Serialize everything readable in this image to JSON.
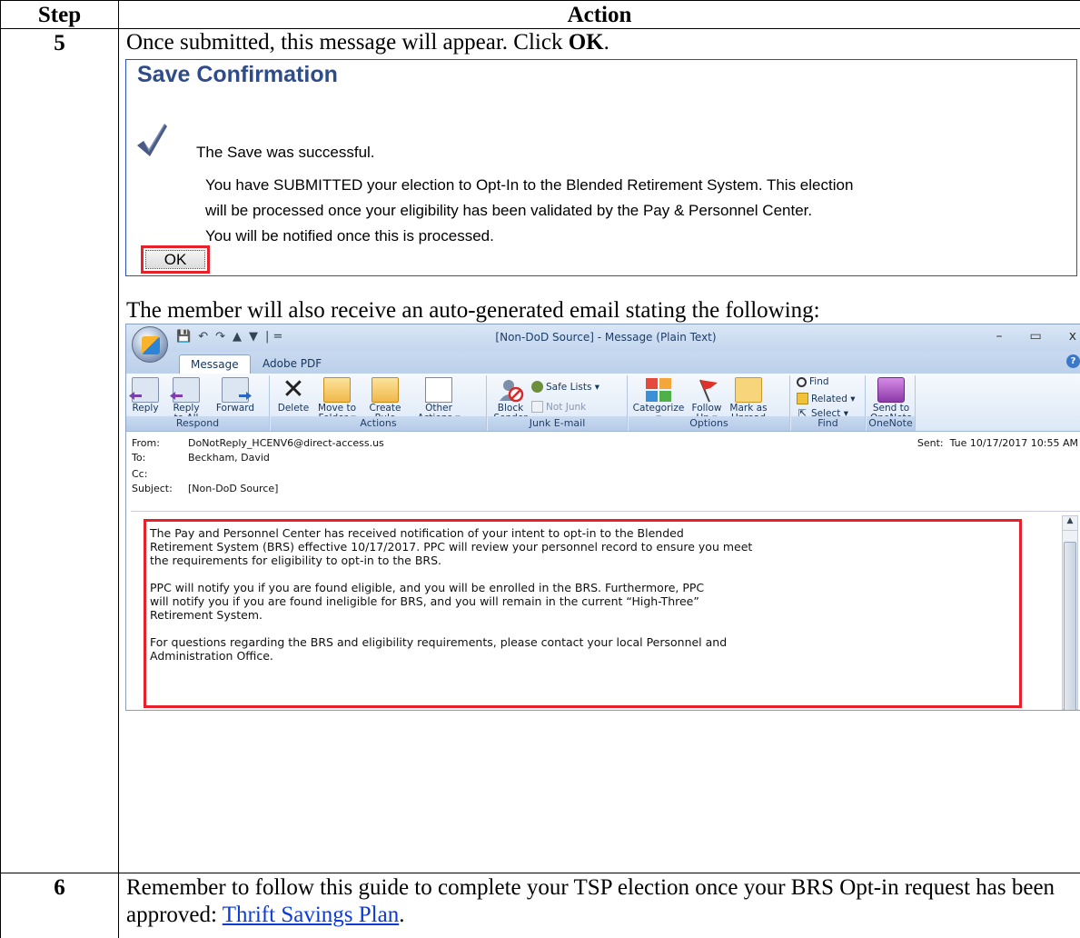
{
  "table": {
    "col_step": "Step",
    "col_action": "Action",
    "rows": [
      {
        "step": "5",
        "intro_prefix": "Once submitted, this message will appear. Click ",
        "intro_bold": "OK",
        "intro_suffix": "."
      },
      {
        "step": "6",
        "text_prefix": "Remember to follow this guide to complete your TSP election once your BRS Opt-in request has been approved: ",
        "link": "Thrift Savings Plan",
        "text_suffix": "."
      }
    ]
  },
  "save_confirmation": {
    "title": "Save Confirmation",
    "success": "The Save was successful.",
    "lines": [
      "You have SUBMITTED your election to Opt-In to the Blended Retirement System. This election",
      "will be processed once your eligibility has been validated by the Pay & Personnel Center.",
      "You will be notified once this is processed."
    ],
    "ok_label": "OK"
  },
  "email_intro": "The member will also receive an auto-generated email stating the following:",
  "email": {
    "window_title": "[Non-DoD Source]  - Message (Plain Text)",
    "tabs": [
      "Message",
      "Adobe PDF"
    ],
    "help_glyph": "?",
    "controls": {
      "minimize": "–",
      "maximize": "▭",
      "close": "x"
    },
    "quick_access": [
      "💾",
      "↶",
      "↷",
      "▲",
      "▼",
      "| ="
    ],
    "ribbon": {
      "groups": {
        "respond": "Respond",
        "actions": "Actions",
        "junk": "Junk E-mail",
        "options": "Options",
        "find": "Find",
        "onenote": "OneNote"
      },
      "buttons": {
        "reply": "Reply",
        "reply_all_1": "Reply",
        "reply_all_2": "to All",
        "forward": "Forward",
        "delete": "Delete",
        "move_1": "Move to",
        "move_2": "Folder ▾",
        "create_1": "Create",
        "create_2": "Rule",
        "other_1": "Other",
        "other_2": "Actions ▾",
        "block_1": "Block",
        "block_2": "Sender",
        "safe_lists": "Safe Lists ▾",
        "not_junk": "Not Junk",
        "categorize_1": "Categorize",
        "categorize_2": "▾",
        "follow_1": "Follow",
        "follow_2": "Up ▾",
        "mark_1": "Mark as",
        "mark_2": "Unread",
        "find": "Find",
        "related": "Related ▾",
        "select": "Select ▾",
        "send_onenote_1": "Send to",
        "send_onenote_2": "OneNote"
      }
    },
    "header": {
      "from_label": "From:",
      "from_value": "DoNotReply_HCENV6@direct-access.us",
      "to_label": "To:",
      "to_value": "Beckham, David",
      "cc_label": "Cc:",
      "subject_label": "Subject:",
      "subject_value": "[Non-DoD Source]",
      "sent_label": "Sent:",
      "sent_value": "Tue 10/17/2017 10:55 AM"
    },
    "body": [
      "The Pay and Personnel Center has received notification of your intent to opt-in to the Blended\nRetirement System (BRS) effective 10/17/2017. PPC will review your personnel record to ensure you meet\nthe requirements for eligibility to opt-in to the BRS.",
      "PPC will notify you if you are found eligible, and you will be enrolled in the BRS. Furthermore, PPC\nwill notify you if you are found ineligible for BRS, and you will remain in the current “High-Three”\nRetirement System.",
      "For questions regarding the BRS and eligibility requirements, please contact your local Personnel and\nAdministration Office."
    ]
  },
  "colors": {
    "accent_red": "#e8202a",
    "title_blue": "#2e4c8a",
    "link_blue": "#0b3bd8",
    "border_blue": "#2a4fc4"
  },
  "icons": [
    "checkmark-icon",
    "reply-icon",
    "reply-all-icon",
    "forward-icon",
    "delete-icon",
    "move-folder-icon",
    "create-rule-icon",
    "other-actions-icon",
    "block-sender-icon",
    "safe-lists-icon",
    "not-junk-icon",
    "categorize-icon",
    "follow-up-flag-icon",
    "mark-unread-icon",
    "find-icon",
    "related-icon",
    "select-icon",
    "onenote-icon"
  ]
}
